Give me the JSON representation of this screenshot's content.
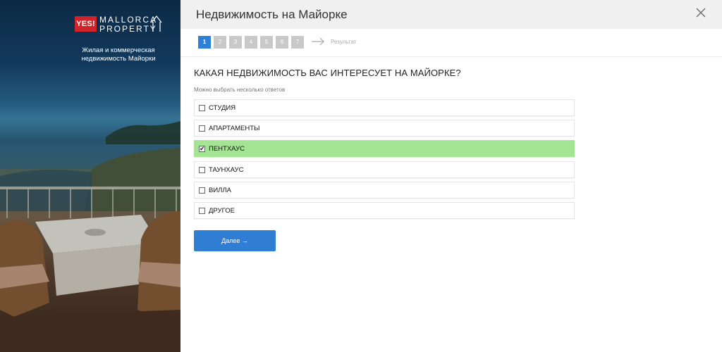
{
  "brand": {
    "badge": "YES!",
    "name_line1": "MALLORCA",
    "name_line2": "PROPERTY",
    "tagline_line1": "Жилая и коммерческая",
    "tagline_line2": "недвижимость Майорки",
    "badge_color": "#d0232a"
  },
  "modal": {
    "title": "Недвижимость на Майорке",
    "close_icon": "close-icon"
  },
  "steps": {
    "items": [
      "1",
      "2",
      "3",
      "4",
      "5",
      "6",
      "7"
    ],
    "active_index": 0,
    "result_label": "Результат",
    "active_color": "#2d7fd9"
  },
  "question": {
    "text": "КАКАЯ НЕДВИЖИМОСТЬ ВАС ИНТЕРЕСУЕТ НА МАЙОРКЕ?",
    "hint": "Можно выбрать несколько ответов"
  },
  "options": [
    {
      "label": "СТУДИЯ",
      "checked": false
    },
    {
      "label": "АПАРТАМЕНТЫ",
      "checked": false
    },
    {
      "label": "ПЕНТХАУС",
      "checked": true
    },
    {
      "label": "ТАУНХАУС",
      "checked": false
    },
    {
      "label": "ВИЛЛА",
      "checked": false
    },
    {
      "label": "ДРУГОЕ",
      "checked": false
    }
  ],
  "checked_color": "#a4e594",
  "next_button": {
    "label": "Далее →",
    "color": "#2f7ed3"
  }
}
